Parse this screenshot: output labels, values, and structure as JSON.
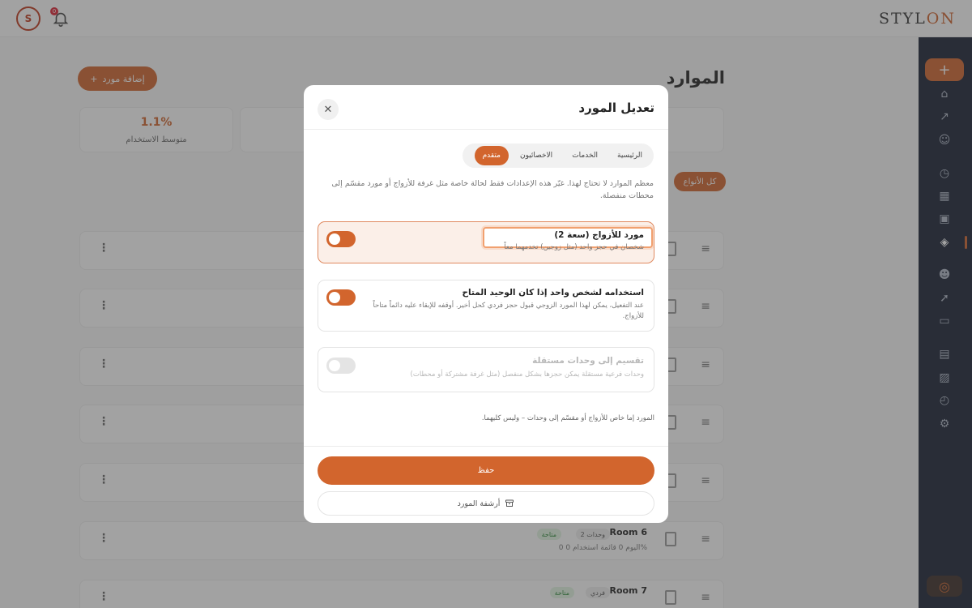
{
  "header": {
    "avatar_initial": "S",
    "notification_count": "0",
    "logo_main": "STYL",
    "logo_accent": "ON"
  },
  "page": {
    "title": "الموارد",
    "add_button_label": "إضافة مورد",
    "stats": [
      {
        "value": "1.1%",
        "label": "متوسط الاستخدام"
      }
    ],
    "filter_chip": "كل الأنواع",
    "rows": [
      {
        "name": "Room 6",
        "badge_primary": "2 وحدات",
        "badge_status": "متاحة",
        "meta": "0 اليوم   0 قائمة   استخدام 0%"
      },
      {
        "name": "Room 7",
        "badge_primary": "فردي",
        "badge_status": "متاحة",
        "meta": ""
      }
    ]
  },
  "modal": {
    "title": "تعديل المورد",
    "tabs": [
      {
        "label": "الرئيسية",
        "active": false
      },
      {
        "label": "الخدمات",
        "active": false
      },
      {
        "label": "الاخصائيون",
        "active": false
      },
      {
        "label": "متقدم",
        "active": true
      }
    ],
    "intro": "معظم الموارد لا تحتاج لهذا. غيّر هذه الإعدادات فقط لحالة خاصة مثل غرفة للأزواج أو مورد مقسّم إلى محطات منفصلة.",
    "options": [
      {
        "title": "مورد للأزواج (سعة 2)",
        "description": "شخصان في حجز واحد (مثل زوجين) تخدمهما معاً",
        "on": true,
        "highlight": true,
        "disabled": false
      },
      {
        "title": "استخدامه لشخص واحد إذا كان الوحيد المتاح",
        "description": "عند التفعيل، يمكن لهذا المورد الزوجي قبول حجز فردي كحل أخير. أوقفه للإبقاء عليه دائماً متاحاً للأزواج.",
        "on": true,
        "highlight": false,
        "disabled": false
      },
      {
        "title": "تقسيم إلى وحدات مستقلة",
        "description": "وحدات فرعية مستقلة يمكن حجزها بشكل منفصل (مثل غرفة مشتركة أو محطات)",
        "on": false,
        "highlight": false,
        "disabled": true
      }
    ],
    "footer_note": "المورد إما خاص للأزواج أو مقسّم إلى وحدات – وليس كليهما.",
    "save_label": "حفظ",
    "archive_label": "أرشفة المورد"
  }
}
